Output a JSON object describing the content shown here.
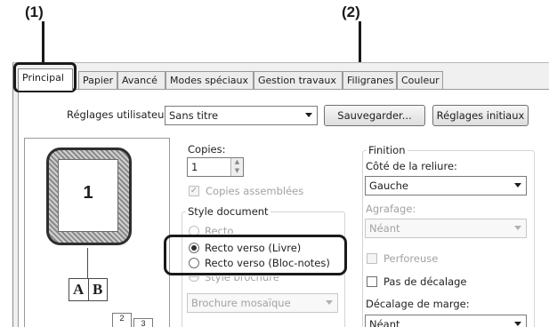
{
  "callouts": {
    "one": "(1)",
    "two": "(2)"
  },
  "tabs": [
    "Principal",
    "Papier",
    "Avancé",
    "Modes spéciaux",
    "Gestion travaux",
    "Filigranes",
    "Couleur"
  ],
  "user_settings": {
    "label": "Réglages utilisateur:",
    "value": "Sans titre",
    "save_button": "Sauvegarder...",
    "defaults_button": "Réglages initiaux"
  },
  "preview": {
    "page_number": "1",
    "book_left": "A",
    "book_right": "B"
  },
  "copies": {
    "label": "Copies:",
    "value": "1",
    "collate_label": "Copies assemblées",
    "collate_check": "✓"
  },
  "document_style": {
    "title": "Style document",
    "options": [
      "Recto",
      "Recto verso (Livre)",
      "Recto verso (Bloc-notes)",
      "Style brochure"
    ],
    "booklet": "Brochure mosaïque"
  },
  "finishing": {
    "title": "Finition",
    "binding_label": "Côté de la reliure:",
    "binding_value": "Gauche",
    "staple_label": "Agrafage:",
    "staple_value": "Néant",
    "punch_label": "Perforeuse",
    "no_offset_label": "Pas de décalage",
    "margin_label": "Décalage de marge:",
    "margin_value": "Néant"
  }
}
